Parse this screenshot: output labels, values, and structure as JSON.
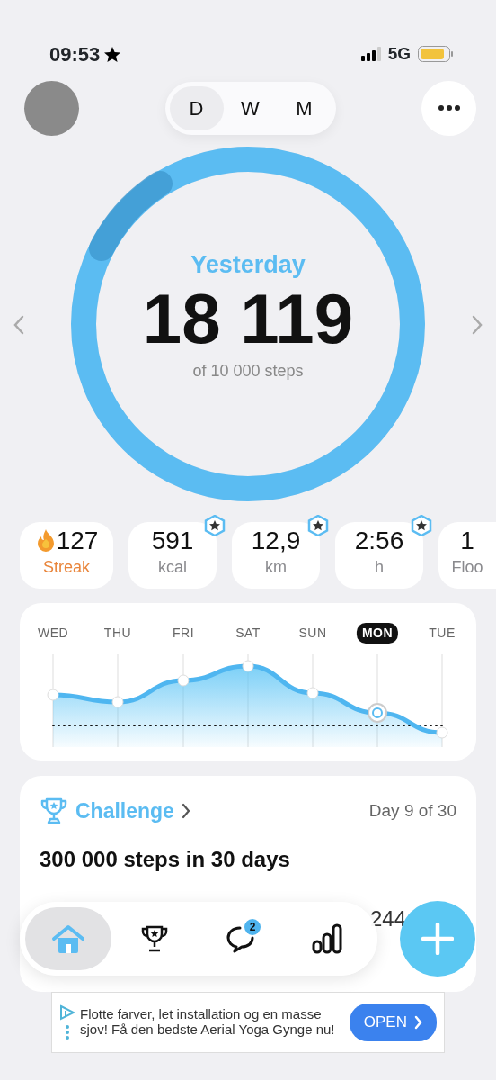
{
  "status_bar": {
    "time": "09:53",
    "network": "5G"
  },
  "period_tabs": [
    {
      "label": "D",
      "selected": true
    },
    {
      "label": "W",
      "selected": false
    },
    {
      "label": "M",
      "selected": false
    }
  ],
  "ring": {
    "title": "Yesterday",
    "steps": "18 119",
    "goal": "of 10 000 steps",
    "level": 1
  },
  "stats": [
    {
      "kind": "streak",
      "value": "127",
      "label": "Streak",
      "badge": false
    },
    {
      "kind": "metric",
      "value": "591",
      "label": "kcal",
      "badge": true
    },
    {
      "kind": "metric",
      "value": "12,9",
      "label": "km",
      "badge": true
    },
    {
      "kind": "metric",
      "value": "2:56",
      "label": "h",
      "badge": true
    },
    {
      "kind": "metric",
      "value": "1",
      "label": "Floo",
      "badge": false
    }
  ],
  "week_days": [
    {
      "label": "WED",
      "selected": false
    },
    {
      "label": "THU",
      "selected": false
    },
    {
      "label": "FRI",
      "selected": false
    },
    {
      "label": "SAT",
      "selected": false
    },
    {
      "label": "SUN",
      "selected": false
    },
    {
      "label": "MON",
      "selected": true
    },
    {
      "label": "TUE",
      "selected": false
    }
  ],
  "challenge": {
    "title": "Challenge",
    "progress": "Day 9 of 30",
    "name": "300 000 steps in 30 days",
    "leaderboard_value": "244"
  },
  "tab_bar": [
    {
      "kind": "home",
      "selected": true
    },
    {
      "kind": "trophy",
      "selected": false
    },
    {
      "kind": "chat",
      "selected": false,
      "badge": "2"
    },
    {
      "kind": "stats",
      "selected": false
    }
  ],
  "ad": {
    "text": "Flotte farver, let installation og en masse sjov! Få den bedste Aerial Yoga Gynge nu!",
    "button": "OPEN"
  }
}
